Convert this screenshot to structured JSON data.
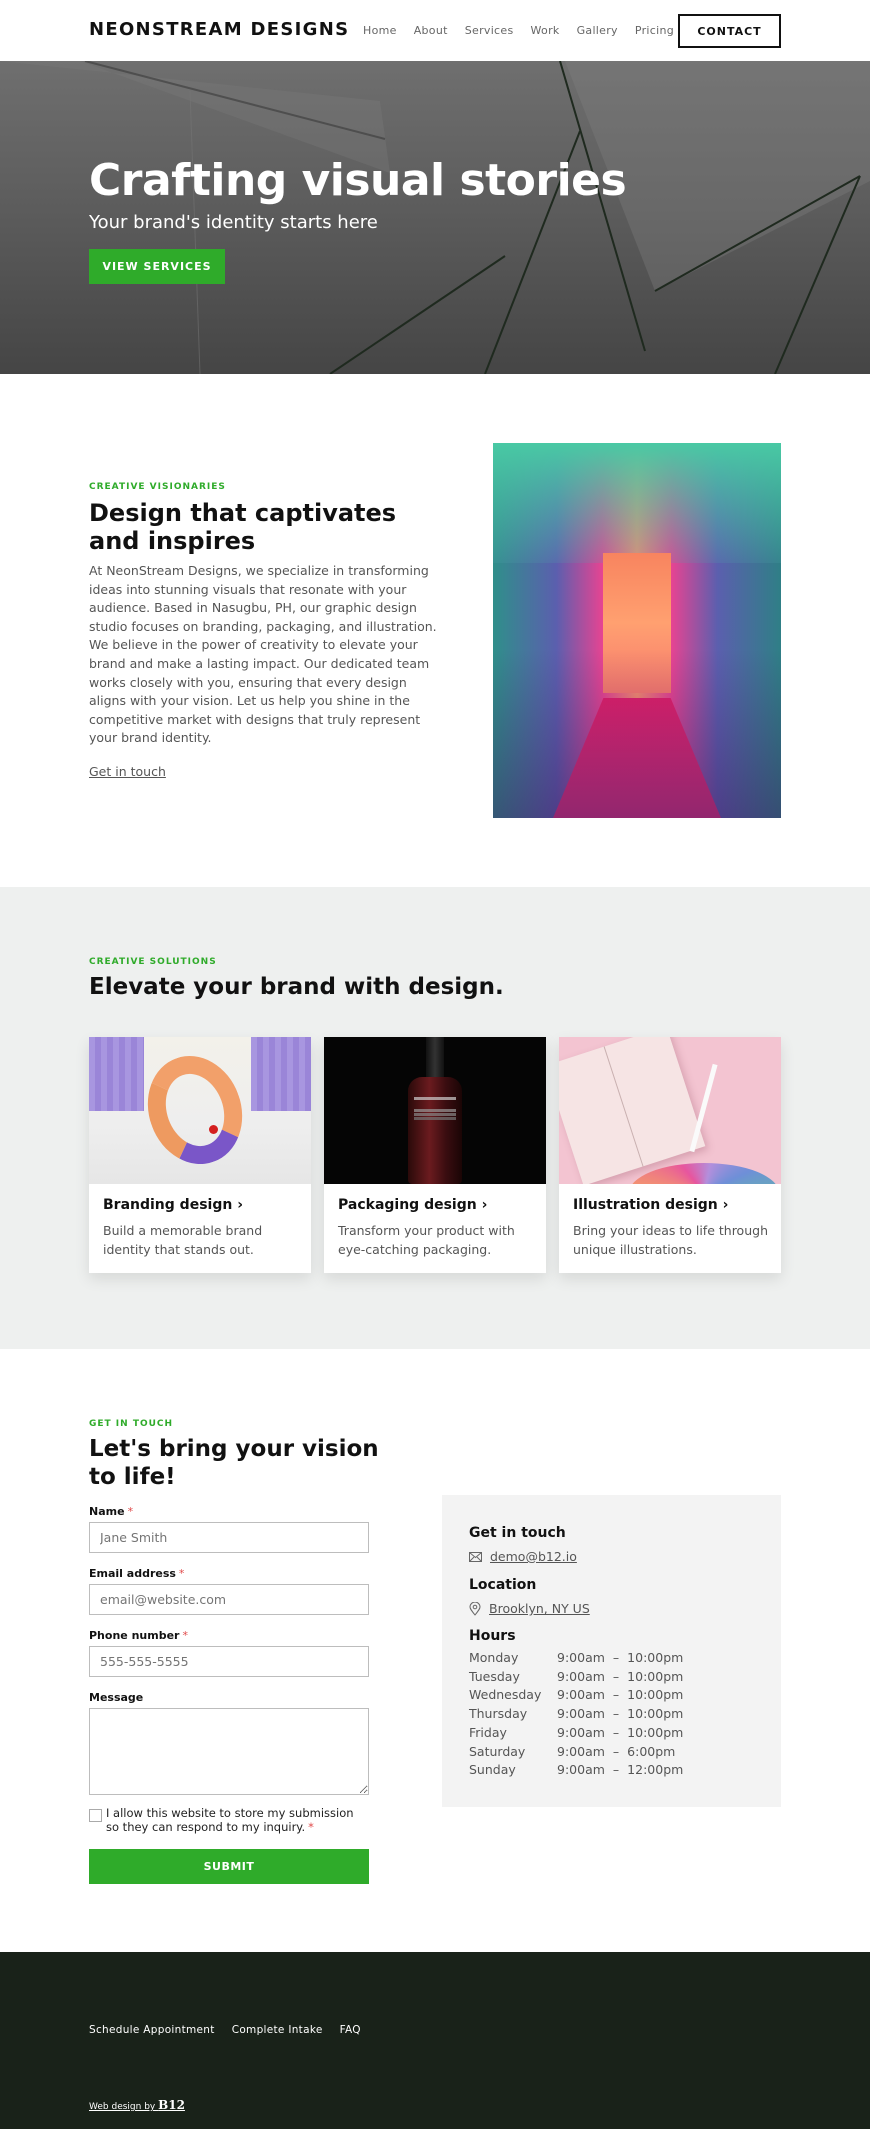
{
  "header": {
    "logo": "NEONSTREAM DESIGNS",
    "nav": [
      "Home",
      "About",
      "Services",
      "Work",
      "Gallery",
      "Pricing"
    ],
    "contact_label": "CONTACT"
  },
  "hero": {
    "title": "Crafting visual stories",
    "subtitle": "Your brand's identity starts here",
    "button_label": "VIEW SERVICES"
  },
  "about": {
    "eyebrow": "CREATIVE VISIONARIES",
    "title": "Design that captivates and inspires",
    "body": "At NeonStream Designs, we specialize in transforming ideas into stunning visuals that resonate with your audience. Based in Nasugbu, PH, our graphic design studio focuses on branding, packaging, and illustration. We believe in the power of creativity to elevate your brand and make a lasting impact. Our dedicated team works closely with you, ensuring that every design aligns with your vision. Let us help you shine in the competitive market with designs that truly represent your brand identity.",
    "link_label": "Get in touch",
    "image_alt": "neon-hallway-photo"
  },
  "services": {
    "eyebrow": "CREATIVE SOLUTIONS",
    "title": "Elevate your brand with design.",
    "cards": [
      {
        "title": "Branding design",
        "desc": "Build a memorable brand identity that stands out."
      },
      {
        "title": "Packaging design",
        "desc": "Transform your product with eye-catching packaging."
      },
      {
        "title": "Illustration design",
        "desc": "Bring your ideas to life through unique illustrations."
      }
    ],
    "chevron": "›"
  },
  "contact": {
    "eyebrow": "GET IN TOUCH",
    "title": "Let's bring your vision to life!",
    "form": {
      "name_label": "Name",
      "name_placeholder": "Jane Smith",
      "email_label": "Email address",
      "email_placeholder": "email@website.com",
      "phone_label": "Phone number",
      "phone_placeholder": "555-555-5555",
      "message_label": "Message",
      "message_value": "",
      "required_mark": "*",
      "consent_text": "I allow this website to store my submission so they can respond to my inquiry.",
      "consent_checked": false,
      "submit_label": "SUBMIT"
    },
    "info": {
      "touch_heading": "Get in touch",
      "email": "demo@b12.io",
      "location_heading": "Location",
      "location": "Brooklyn, NY US",
      "hours_heading": "Hours",
      "hours": [
        {
          "day": "Monday",
          "open": "9:00am",
          "close": "10:00pm"
        },
        {
          "day": "Tuesday",
          "open": "9:00am",
          "close": "10:00pm"
        },
        {
          "day": "Wednesday",
          "open": "9:00am",
          "close": "10:00pm"
        },
        {
          "day": "Thursday",
          "open": "9:00am",
          "close": "10:00pm"
        },
        {
          "day": "Friday",
          "open": "9:00am",
          "close": "10:00pm"
        },
        {
          "day": "Saturday",
          "open": "9:00am",
          "close": "6:00pm"
        },
        {
          "day": "Sunday",
          "open": "9:00am",
          "close": "12:00pm"
        }
      ],
      "dash": "–"
    }
  },
  "footer": {
    "links": [
      "Schedule Appointment",
      "Complete Intake",
      "FAQ"
    ],
    "credit_prefix": "Web design by ",
    "credit_brand": "B12"
  },
  "colors": {
    "accent": "#2fab2a",
    "footer_bg": "#192219",
    "services_bg": "#eef0ef",
    "info_bg": "#f3f3f3"
  }
}
